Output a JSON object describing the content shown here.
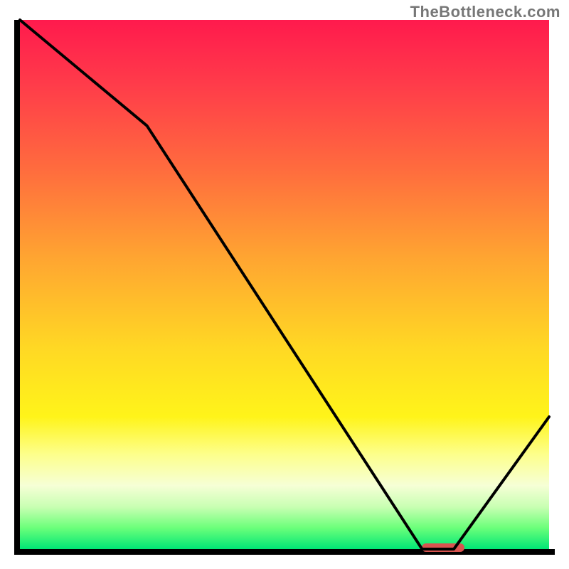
{
  "watermark": "TheBottleneck.com",
  "chart_data": {
    "type": "line",
    "title": "",
    "xlabel": "",
    "ylabel": "",
    "xlim": [
      0,
      100
    ],
    "ylim": [
      0,
      100
    ],
    "x": [
      0,
      24,
      76,
      82,
      100
    ],
    "values": [
      100,
      80,
      0,
      0,
      25
    ],
    "marker": {
      "x_start": 76,
      "x_end": 84,
      "y": 0
    },
    "gradient_stops": [
      {
        "pos": 0,
        "color": "#ff1a4d"
      },
      {
        "pos": 45,
        "color": "#ffa531"
      },
      {
        "pos": 75,
        "color": "#fff41a"
      },
      {
        "pos": 100,
        "color": "#00e676"
      }
    ]
  },
  "colors": {
    "axis": "#000000",
    "curve": "#000000",
    "marker": "#d9534f",
    "watermark": "#777777"
  }
}
